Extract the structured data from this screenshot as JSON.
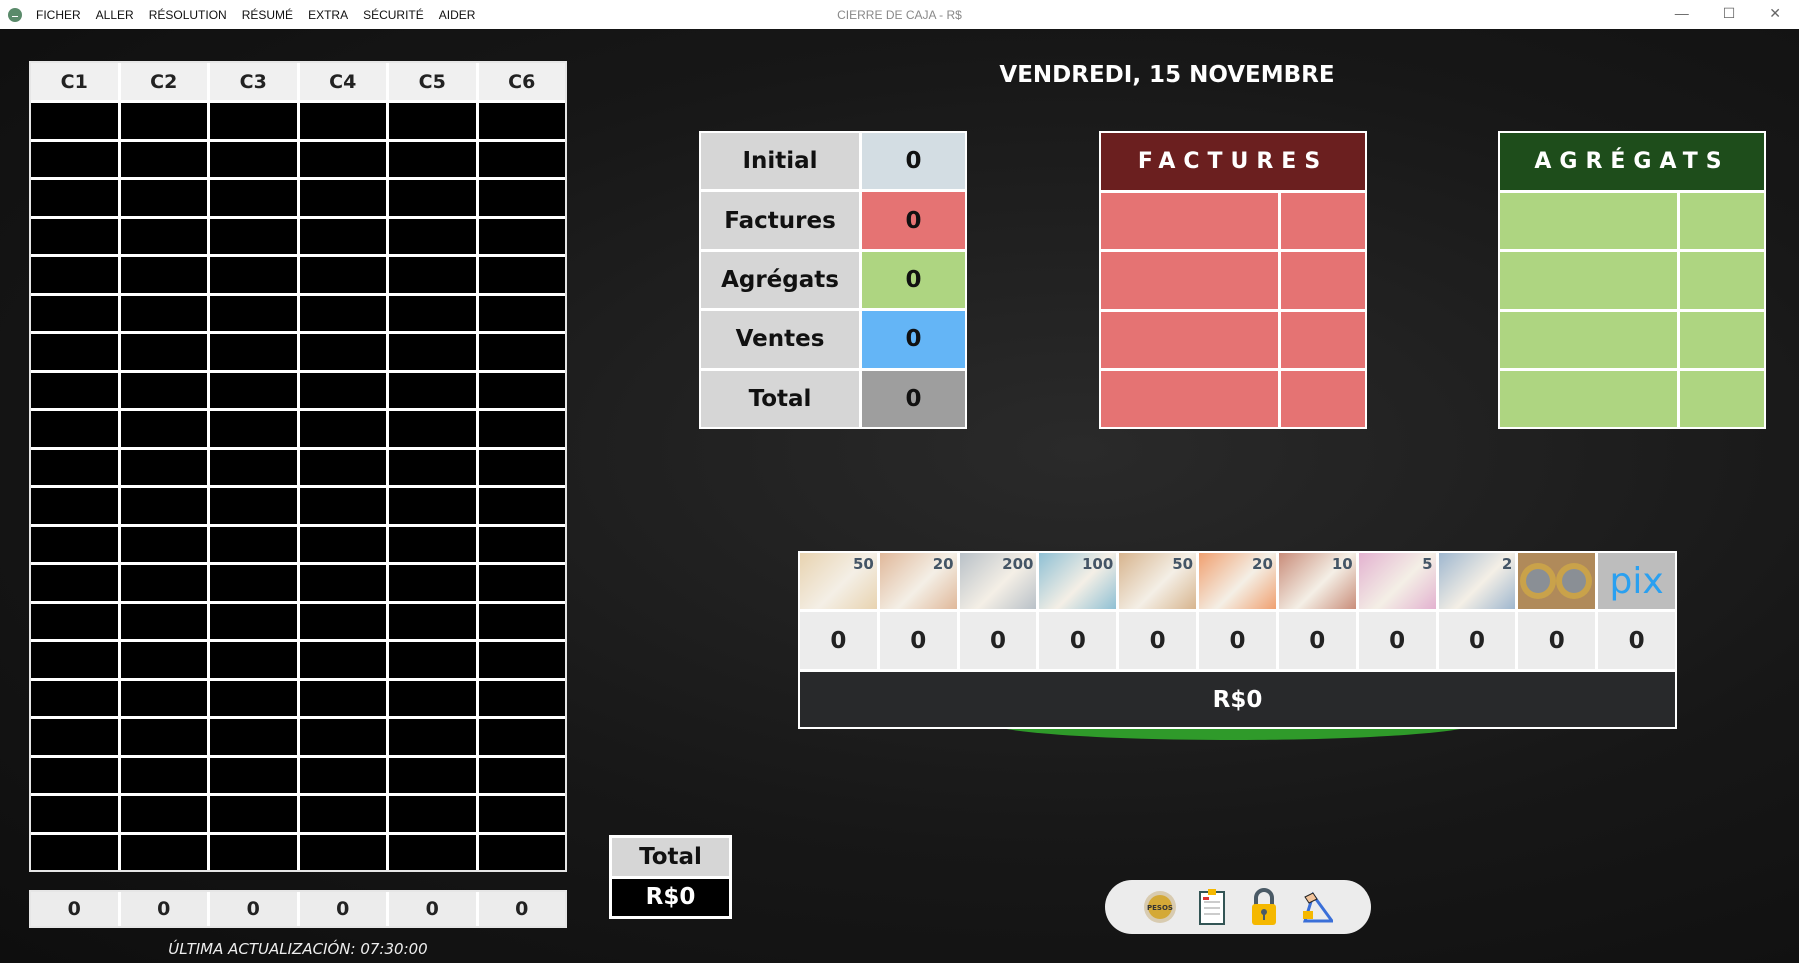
{
  "window": {
    "title": "CIERRE DE CAJA - R$",
    "menu": [
      "FICHER",
      "ALLER",
      "RÉSOLUTION",
      "RÉSUMÉ",
      "EXTRA",
      "SÉCURITÉ",
      "AIDER"
    ]
  },
  "grid": {
    "headers": [
      "C1",
      "C2",
      "C3",
      "C4",
      "C5",
      "C6"
    ],
    "rows": 20,
    "totals": [
      "0",
      "0",
      "0",
      "0",
      "0",
      "0"
    ],
    "last_update": "ÚLTIMA ACTUALIZACIÓN: 07:30:00"
  },
  "date": "VENDREDI, 15 NOVEMBRE",
  "summary": [
    {
      "label": "Initial",
      "value": "0",
      "color": "#d3dde3"
    },
    {
      "label": "Factures",
      "value": "0",
      "color": "#e57373"
    },
    {
      "label": "Agrégats",
      "value": "0",
      "color": "#aed581"
    },
    {
      "label": "Ventes",
      "value": "0",
      "color": "#64b5f6"
    },
    {
      "label": "Total",
      "value": "0",
      "color": "#9e9e9e"
    }
  ],
  "factures": {
    "title": "FACTURES",
    "header_color": "#6b1f1f",
    "cell_color": "#e57373"
  },
  "agregats": {
    "title": "AGRÉGATS",
    "header_color": "#1e4d1b",
    "cell_color": "#aed581"
  },
  "money": {
    "items": [
      {
        "name": "bundle-50",
        "den": "50",
        "color": "#e8d3b0"
      },
      {
        "name": "bundle-20",
        "den": "20",
        "color": "#e0b89a"
      },
      {
        "name": "bill-200",
        "den": "200",
        "color": "#b9c1c8"
      },
      {
        "name": "bill-100",
        "den": "100",
        "color": "#8fc0d4"
      },
      {
        "name": "bill-50",
        "den": "50",
        "color": "#d7b48e"
      },
      {
        "name": "bill-20",
        "den": "20",
        "color": "#f0a070"
      },
      {
        "name": "bill-10",
        "den": "10",
        "color": "#c98d7a"
      },
      {
        "name": "bill-5",
        "den": "5",
        "color": "#e3b2d0"
      },
      {
        "name": "bill-2",
        "den": "2",
        "color": "#9fb7cf"
      },
      {
        "name": "coins",
        "den": "",
        "color": "#b08a5a"
      },
      {
        "name": "pix",
        "den": "pix",
        "color": "#bdbdbd"
      }
    ],
    "counts": [
      "0",
      "0",
      "0",
      "0",
      "0",
      "0",
      "0",
      "0",
      "0",
      "0",
      "0"
    ],
    "total": "R$0"
  },
  "total_box": {
    "label": "Total",
    "value": "R$0"
  },
  "toolbar": {
    "pesos_label": "PESOS"
  }
}
